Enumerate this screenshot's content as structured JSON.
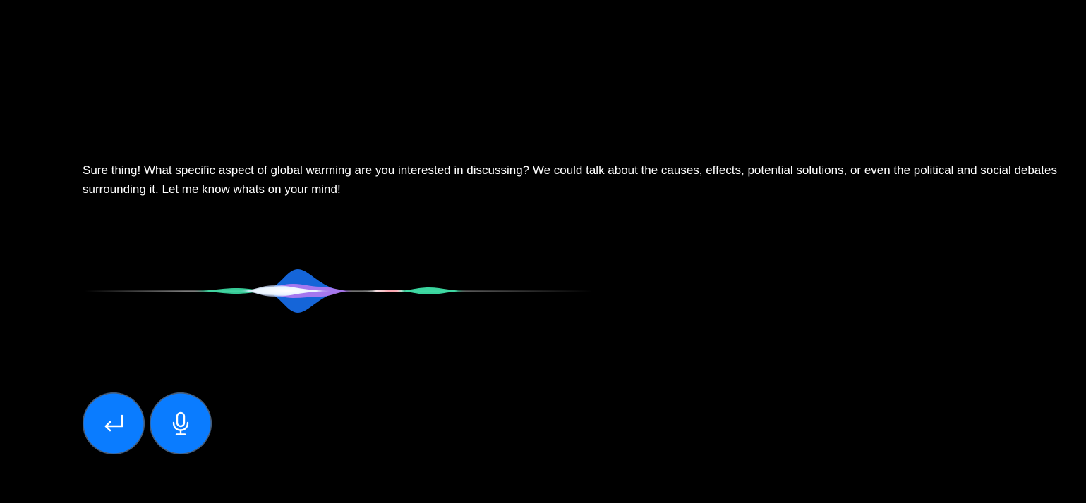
{
  "assistant": {
    "response_text": "Sure thing! What specific aspect of global warming are you interested in discussing? We could talk about the causes, effects, potential solutions, or even the political and social debates surrounding it. Let me know whats on your mind!"
  },
  "waveform": {
    "colors": {
      "blue": "#1565d8",
      "purple": "#b57af2",
      "teal": "#3ddfa6",
      "white": "#ffffff",
      "red": "#ff5a6e"
    }
  },
  "controls": {
    "send_icon": "enter-arrow-icon",
    "mic_icon": "microphone-icon",
    "button_color": "#0a7cff"
  }
}
